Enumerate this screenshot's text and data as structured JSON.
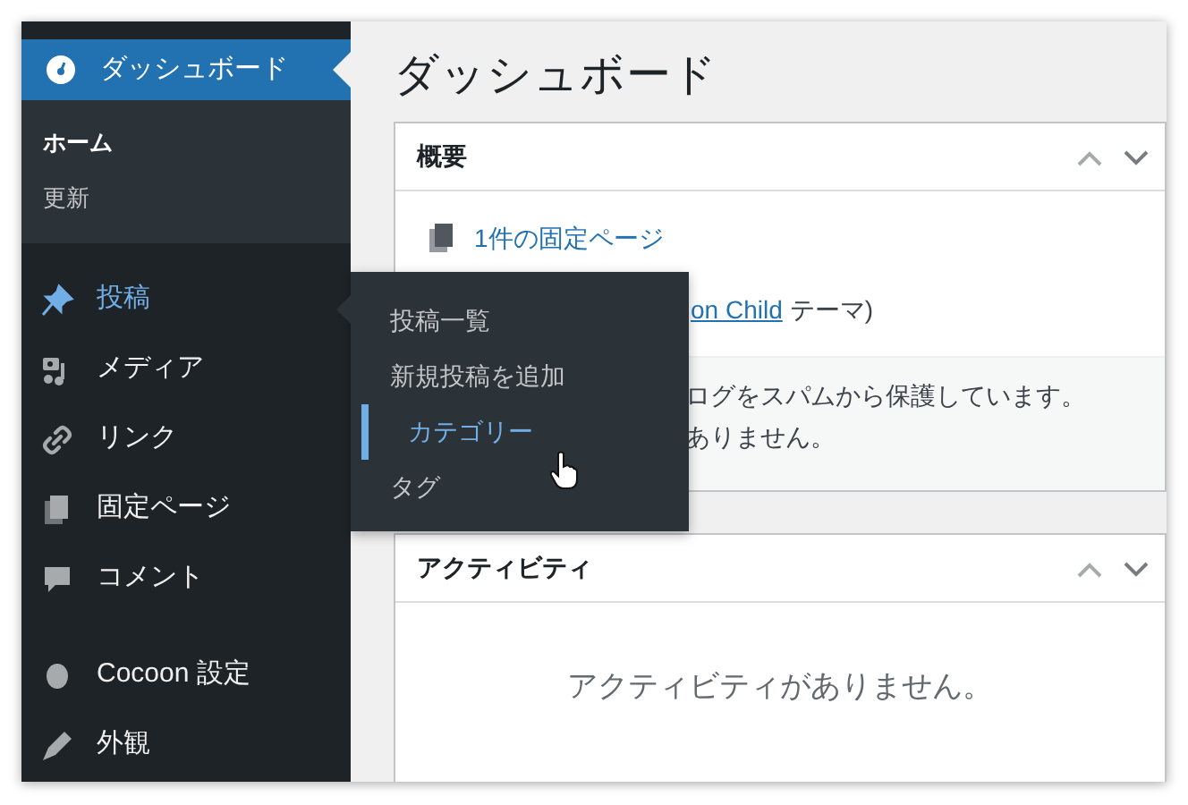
{
  "sidebar": {
    "items": [
      {
        "label": "ダッシュボード",
        "kind": "current",
        "children": [
          {
            "label": "ホーム",
            "selected": true
          },
          {
            "label": "更新",
            "selected": false
          }
        ]
      },
      {
        "label": "投稿",
        "kind": "hover"
      },
      {
        "label": "メディア",
        "kind": "plain"
      },
      {
        "label": "リンク",
        "kind": "plain"
      },
      {
        "label": "固定ページ",
        "kind": "plain"
      },
      {
        "label": "コメント",
        "kind": "plain"
      },
      {
        "label": "Cocoon 設定",
        "kind": "separated"
      },
      {
        "label": "外観",
        "kind": "plain"
      }
    ]
  },
  "flyout": {
    "items": [
      {
        "label": "投稿一覧",
        "selected": false
      },
      {
        "label": "新規投稿を追加",
        "selected": false
      },
      {
        "label": "カテゴリー",
        "selected": true
      },
      {
        "label": "タグ",
        "selected": false
      }
    ]
  },
  "main": {
    "title": "ダッシュボード",
    "panels": [
      {
        "kind": "glance",
        "title": "概要",
        "link": "1件の固定ページ",
        "theme_link": "on Child",
        "theme_text": "テーマ)",
        "notice_lines": [
          "ログをスパムから保護しています。",
          "ありません。"
        ]
      },
      {
        "kind": "activity",
        "title": "アクティビティ",
        "empty_text": "アクティビティがありません。"
      }
    ]
  }
}
